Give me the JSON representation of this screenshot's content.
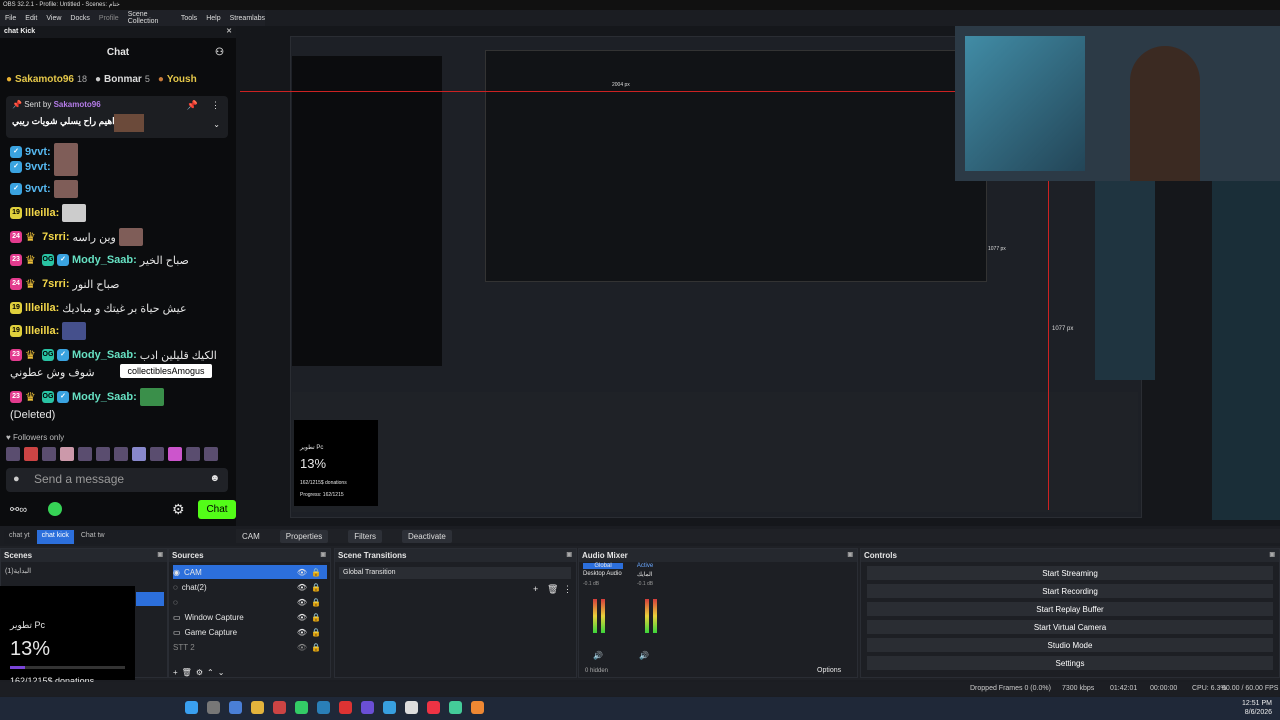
{
  "window": {
    "title": "OBS 32.2.1 - Profile: Untitled - Scenes: ختام"
  },
  "menu": [
    "File",
    "Edit",
    "View",
    "Docks",
    "Profile",
    "Scene Collection",
    "Tools",
    "Help",
    "Streamlabs"
  ],
  "chat_dock": {
    "title": "chat Kick",
    "header": "Chat"
  },
  "top_gifters": [
    {
      "name": "Sakamoto96",
      "count": "18"
    },
    {
      "name": "Bonmar",
      "count": "5"
    },
    {
      "name": "Yoush",
      "count": ""
    }
  ],
  "pinned": {
    "sent_by_label": "Sent by",
    "sender": "Sakamoto96",
    "text": "ابراهيم راح يسلي شويات ريبي"
  },
  "messages": [
    {
      "user": "9vvt:",
      "text": ""
    },
    {
      "user": "9vvt:",
      "text": ""
    },
    {
      "user": "9vvt:",
      "text": ""
    },
    {
      "badge": "19",
      "user": "llleilla:",
      "text": ""
    },
    {
      "badge": "24",
      "user": "7srri:",
      "text": "وين راسه"
    },
    {
      "badge": "23",
      "user": "Mody_Saab:",
      "text": "صباح الخير"
    },
    {
      "badge": "24",
      "user": "7srri:",
      "text": "صباح النور"
    },
    {
      "badge": "19",
      "user": "llleilla:",
      "text": "عيش حياة بر غيتك و مباديك"
    },
    {
      "badge": "19",
      "user": "llleilla:",
      "text": ""
    },
    {
      "badge": "23",
      "user": "Mody_Saab:",
      "text": "الكيك قليلين ادب"
    },
    {
      "text": "شوف وش عطوني"
    },
    {
      "badge": "23",
      "user": "Mody_Saab:",
      "text": ""
    },
    {
      "text": "(Deleted)"
    }
  ],
  "tooltip": "collectiblesAmogus",
  "followers_label": "Followers only",
  "send_placeholder": "Send a message",
  "chat_button": "Chat",
  "dock_tabs": [
    "chat yt",
    "chat kick",
    "Chat tw"
  ],
  "source_toolbar": {
    "source": "CAM",
    "properties": "Properties",
    "filters": "Filters",
    "deactivate": "Deactivate"
  },
  "scenes": {
    "title": "Scenes",
    "items": [
      "البداية(1)"
    ]
  },
  "sources": {
    "title": "Sources",
    "items": [
      "CAM",
      "chat(2)",
      "",
      "Window Capture",
      "Game Capture",
      "STT 2",
      ""
    ]
  },
  "transitions": {
    "title": "Scene Transitions",
    "selected": "Global Transition"
  },
  "mixer": {
    "title": "Audio Mixer",
    "tabs": [
      "Global",
      "Active"
    ],
    "channels": [
      "Desktop Audio",
      "المايك"
    ],
    "db": [
      "-0.1 dB",
      "-0.1 dB"
    ],
    "hidden": "0 hidden"
  },
  "controls": {
    "title": "Controls",
    "buttons": [
      "Start Streaming",
      "Start Recording",
      "Start Replay Buffer",
      "Start Virtual Camera",
      "Studio Mode",
      "Settings"
    ]
  },
  "options_label": "Options",
  "progress": {
    "title": "تطوير Pc",
    "percent": "13%",
    "donations": "162/1215$ donations",
    "progress": "Progress: 162/1215",
    "fill": 0.133
  },
  "status": {
    "dropped": "Dropped Frames 0 (0.0%)",
    "bitrate": "7300 kbps",
    "stream_time": "01:42:01",
    "rec_time": "00:00:00",
    "cpu": "CPU: 6.3%",
    "fps": "60.00 / 60.00 FPS"
  },
  "clock": {
    "time": "12:51 PM",
    "date": "8/6/2026"
  },
  "preview": {
    "px1": "1077 px",
    "px2": "1077 px",
    "px3": "2004 px"
  },
  "colors": {
    "kick_green": "#53fc18",
    "obs_blue": "#2c6fdc",
    "gifter_gold": "#e5c84a"
  }
}
